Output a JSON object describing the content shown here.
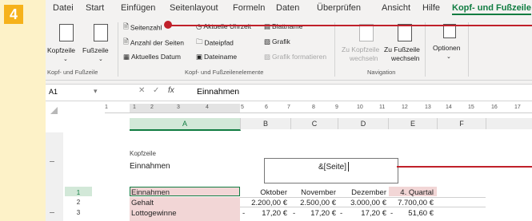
{
  "step_number": "4",
  "menu": {
    "tabs": [
      "Datei",
      "Start",
      "Einfügen",
      "Seitenlayout",
      "Formeln",
      "Daten",
      "Überprüfen",
      "Ansicht",
      "Hilfe"
    ],
    "active_tab": "Kopf- und Fußzeile"
  },
  "ribbon": {
    "kopfzeile": "Kopfzeile",
    "fusszeile": "Fußzeile",
    "seitenzahl": "Seitenzahl",
    "anzahl_seiten": "Anzahl der Seiten",
    "aktuelles_datum": "Aktuelles Datum",
    "aktuelle_uhrzeit": "Aktuelle Uhrzeit",
    "dateipfad": "Dateipfad",
    "dateiname": "Dateiname",
    "blattname": "Blattname",
    "grafik": "Grafik",
    "grafik_formatieren": "Grafik formatieren",
    "zu_kopfzeile_1": "Zu Kopfzeile",
    "zu_kopfzeile_2": "wechseln",
    "zu_fusszeile_1": "Zu Fußzeile",
    "zu_fusszeile_2": "wechseln",
    "optionen": "Optionen",
    "group1": "Kopf- und Fußzeile",
    "group2": "Kopf- und Fußzeilenelemente",
    "group3": "Navigation"
  },
  "formula_bar": {
    "name_box": "A1",
    "fx": "fx",
    "value": "Einnahmen"
  },
  "ruler": [
    "1",
    "1",
    "2",
    "3",
    "4",
    "5",
    "6",
    "7",
    "8",
    "9",
    "10",
    "11",
    "12",
    "13",
    "14",
    "15",
    "16",
    "17"
  ],
  "columns": [
    "A",
    "B",
    "C",
    "D",
    "E",
    "F"
  ],
  "header_area": {
    "label": "Kopfzeile",
    "left": "Einnahmen",
    "center": "&[Seite]"
  },
  "rows": [
    {
      "num": "1",
      "a": "Einnahmen",
      "b": "Oktober",
      "c": "November",
      "d": "Dezember",
      "e": "4. Quartal"
    },
    {
      "num": "2",
      "a": "Gehalt",
      "b": "2.200,00 €",
      "c": "2.500,00 €",
      "d": "3.000,00 €",
      "e": "7.700,00 €"
    },
    {
      "num": "3",
      "a": "Lottogewinne",
      "b_pre": "-",
      "b": "17,20 €",
      "c_pre": "-",
      "c": "17,20 €",
      "d_pre": "-",
      "d": "17,20 €",
      "e_pre": "-",
      "e": "51,60 €"
    }
  ],
  "colors": {
    "accent": "#107c41",
    "callout": "#c0202a",
    "step_badge": "#f6b21b",
    "background": "#fdf2c8"
  }
}
